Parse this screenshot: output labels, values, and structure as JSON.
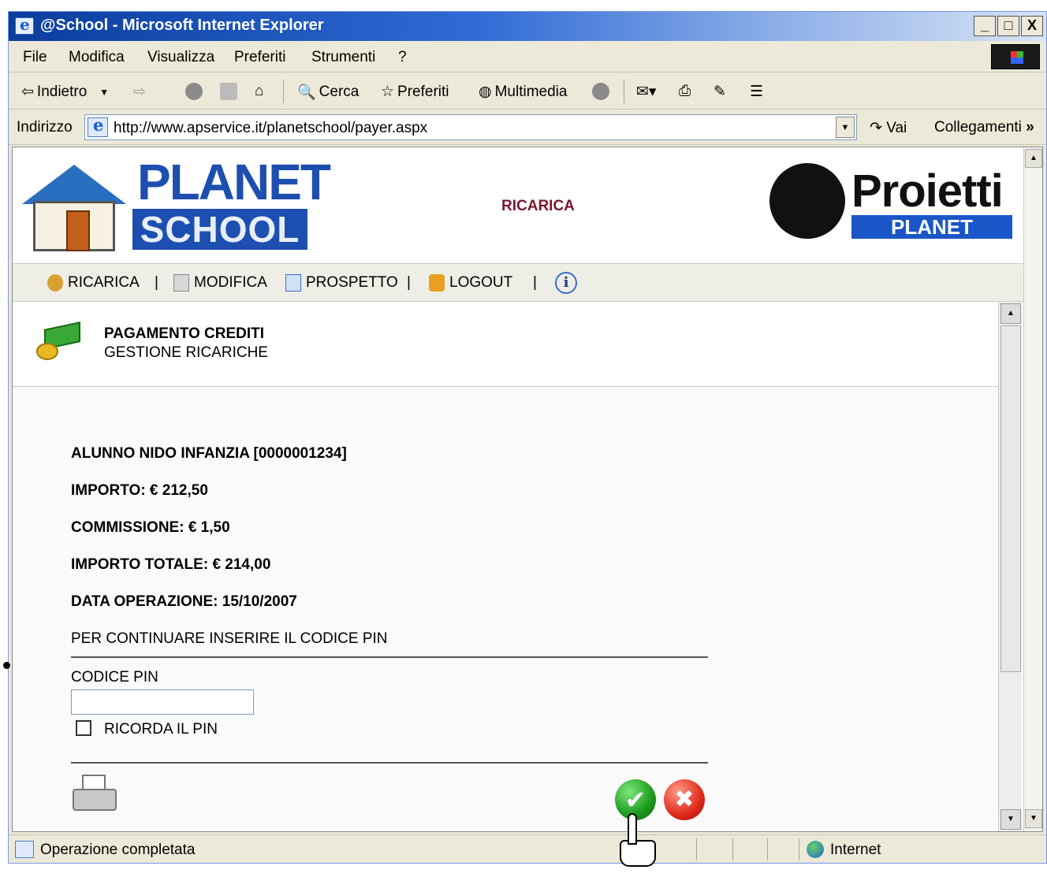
{
  "window": {
    "title": "@School - Microsoft Internet Explorer",
    "buttons": [
      "_",
      "□",
      "X"
    ]
  },
  "menu": [
    "File",
    "Modifica",
    "Visualizza",
    "Preferiti",
    "Strumenti",
    "?"
  ],
  "toolbar": {
    "back_label": "Indietro",
    "search_label": "Cerca",
    "favorites_label": "Preferiti",
    "media_label": "Multimedia"
  },
  "address": {
    "label": "Indirizzo",
    "url": "http://www.apservice.it/planetschool/payer.aspx",
    "go_label": "Vai",
    "links_label": "Collegamenti",
    "chevron": "»"
  },
  "header": {
    "logo_planet": "PLANET",
    "logo_school": "SCHOOL",
    "title": "RICARICA",
    "logo_proietti": "Proietti",
    "logo_proietti_sub": "PLANET"
  },
  "nav": {
    "items": [
      "RICARICA",
      "MODIFICA",
      "PROSPETTO",
      "LOGOUT"
    ],
    "separator": "|",
    "info_symbol": "i"
  },
  "section": {
    "title": "PAGAMENTO CREDITI",
    "subtitle": "GESTIONE RICARICHE"
  },
  "details": {
    "student": "ALUNNO NIDO INFANZIA [0000001234]",
    "amount": "IMPORTO: € 212,50",
    "fee": "COMMISSIONE: € 1,50",
    "total": "IMPORTO TOTALE: € 214,00",
    "date": "DATA OPERAZIONE: 15/10/2007",
    "instruction": "PER CONTINUARE INSERIRE IL CODICE PIN"
  },
  "form": {
    "pin_label": "CODICE PIN",
    "pin_value": "",
    "remember_label": "RICORDA IL PIN",
    "remember_checked": false
  },
  "actions": {
    "ok_symbol": "✔",
    "cancel_symbol": "✖"
  },
  "statusbar": {
    "text": "Operazione completata",
    "zone": "Internet"
  },
  "colors": {
    "title_gradient_start": "#0a3d9c",
    "header_title": "#7a1530",
    "planet_blue": "#1d4fb0",
    "ok_green": "#1b9a1b",
    "cancel_red": "#e02b1b"
  }
}
